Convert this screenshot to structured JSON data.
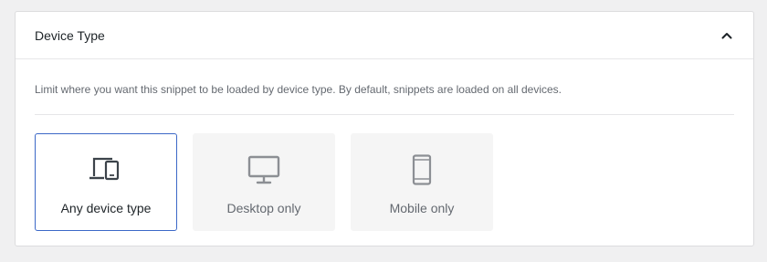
{
  "panel": {
    "title": "Device Type",
    "description": "Limit where you want this snippet to be loaded by device type. By default, snippets are loaded on all devices."
  },
  "options": [
    {
      "label": "Any device type",
      "icon": "devices-icon",
      "selected": true
    },
    {
      "label": "Desktop only",
      "icon": "desktop-icon",
      "selected": false
    },
    {
      "label": "Mobile only",
      "icon": "mobile-icon",
      "selected": false
    }
  ],
  "colors": {
    "selected_border": "#3c68c7",
    "selected_icon": "#3c434a",
    "unselected_icon": "#8c8f94",
    "option_bg": "#f5f5f5"
  }
}
